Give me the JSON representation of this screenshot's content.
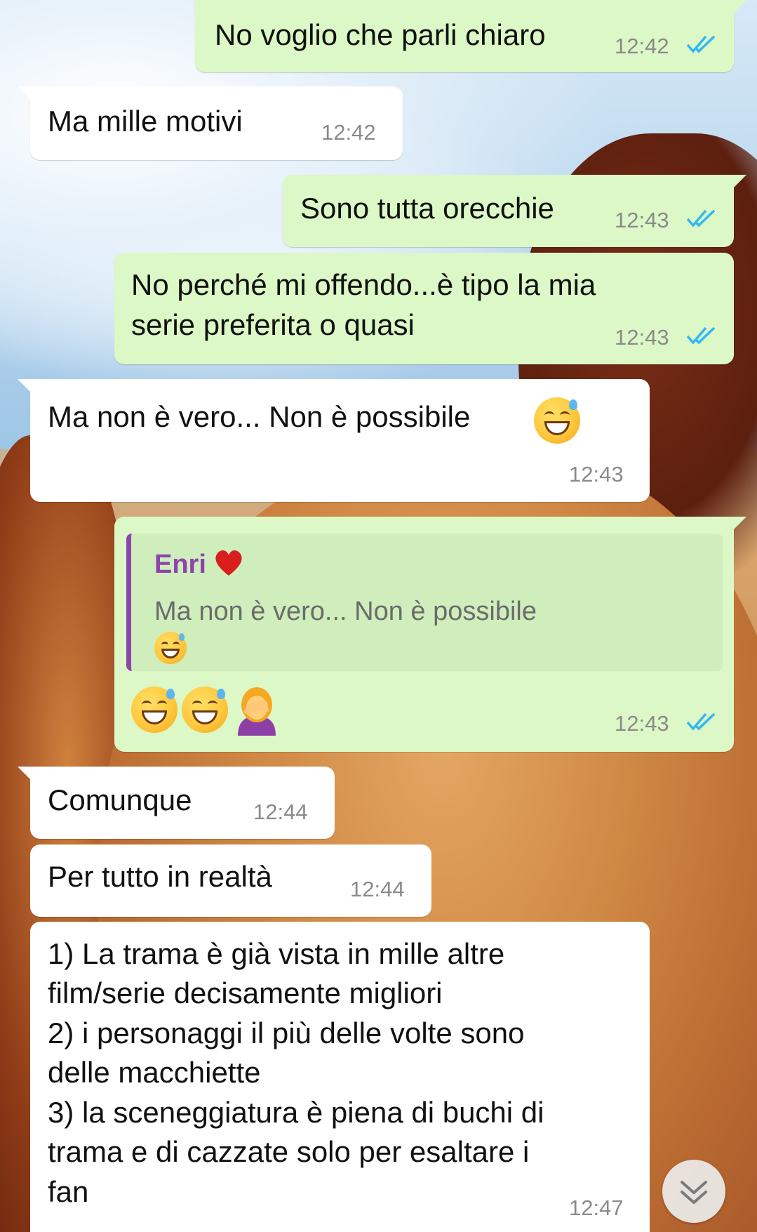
{
  "messages": [
    {
      "text": "No voglio che parli chiaro",
      "time": "12:42"
    },
    {
      "text": "Ma mille motivi",
      "time": "12:42"
    },
    {
      "text": "Sono tutta orecchie",
      "time": "12:43"
    },
    {
      "line1": "No perché mi offendo...è tipo la mia",
      "line2": "serie preferita o quasi",
      "time": "12:43"
    },
    {
      "text": "Ma non è vero... Non è possibile",
      "time": "12:43"
    },
    {
      "quote_author": "Enri",
      "quote_text": "Ma non è vero... Non è possibile",
      "time": "12:43"
    },
    {
      "text": "Comunque",
      "time": "12:44"
    },
    {
      "text": "Per tutto in realtà",
      "time": "12:44"
    },
    {
      "lines": [
        "1) La trama è già vista in mille altre",
        "film/serie decisamente migliori",
        "2) i personaggi il più delle volte sono",
        "delle macchiette",
        "3) la sceneggiatura è piena di buchi di",
        "trama e di cazzate solo per esaltare i",
        "fan"
      ],
      "time": "12:47"
    }
  ],
  "icons": {
    "read_receipt": "double-check-icon",
    "heart": "heart-icon",
    "grin_sweat": "grinning-face-with-sweat-icon",
    "facepalm": "person-facepalming-icon",
    "scroll_down": "chevron-down-icon"
  },
  "colors": {
    "outgoing_bubble": "#dcf8c6",
    "incoming_bubble": "#ffffff",
    "read_tick": "#34b7f1",
    "quote_author": "#8e44ad"
  }
}
